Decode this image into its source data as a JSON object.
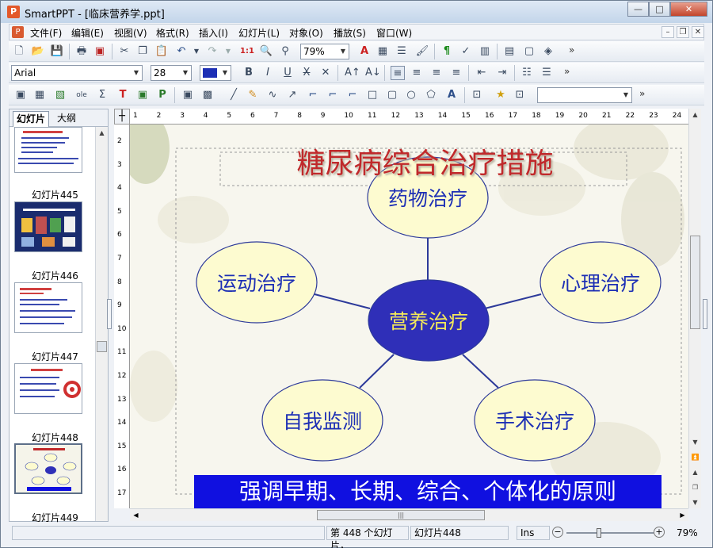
{
  "window": {
    "title": "SmartPPT - [临床营养学.ppt]",
    "app_icon": "P",
    "minimize": "—",
    "maximize": "□",
    "close": "✕"
  },
  "menu": {
    "items": [
      "文件(F)",
      "编辑(E)",
      "视图(V)",
      "格式(R)",
      "插入(I)",
      "幻灯片(L)",
      "对象(O)",
      "播放(S)",
      "窗口(W)"
    ],
    "mdi_minimize": "–",
    "mdi_restore": "❐",
    "mdi_close": "✕"
  },
  "toolbar1": {
    "zoom": "79%",
    "more": "»"
  },
  "toolbar2": {
    "font": "Arial",
    "size": "28",
    "color": "#1d2fb5",
    "more": "»"
  },
  "toolbar3": {
    "more": "»"
  },
  "left_panel": {
    "tab_slides": "幻灯片",
    "tab_outline": "大纲",
    "thumb_labels": [
      "幻灯片445",
      "幻灯片446",
      "幻灯片447",
      "幻灯片448",
      "幻灯片449"
    ]
  },
  "ruler": {
    "h_marks": [
      "1",
      "2",
      "3",
      "4",
      "5",
      "6",
      "7",
      "8",
      "9",
      "10",
      "11",
      "12",
      "13",
      "14",
      "15",
      "16",
      "17",
      "18",
      "19",
      "20",
      "21",
      "22",
      "23",
      "24"
    ],
    "v_marks": [
      "2",
      "3",
      "4",
      "5",
      "6",
      "7",
      "8",
      "9",
      "10",
      "11",
      "12",
      "13",
      "14",
      "15",
      "16",
      "17"
    ]
  },
  "slide": {
    "title": "糖尿病综合治疗措施",
    "center": "营养治疗",
    "nodes": [
      "药物治疗",
      "运动治疗",
      "心理治疗",
      "自我监测",
      "手术治疗"
    ],
    "banner": "强调早期、长期、综合、个体化的原则",
    "colors": {
      "title": "#c0292b",
      "node_fill": "#fdfbd0",
      "node_text": "#1d2fb5",
      "center_fill": "#2f2fb8",
      "center_text": "#f4e95a",
      "banner_bg": "#1010e0",
      "banner_text": "#ffffff"
    }
  },
  "status": {
    "slide_count": "第 448 个幻灯片，",
    "slide_name": "幻灯片448",
    "mode": "Ins",
    "zoom": "79%"
  }
}
